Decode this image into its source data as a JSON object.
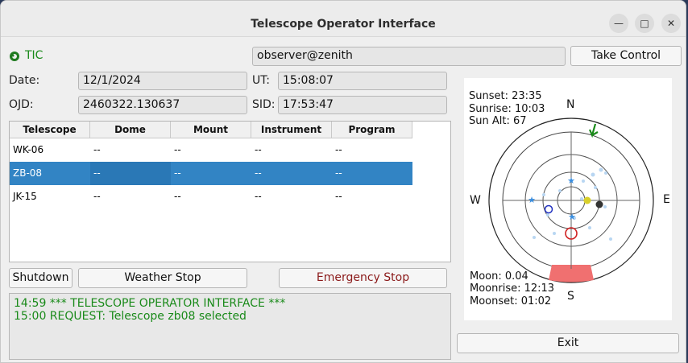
{
  "window": {
    "title": "Telescope Operator Interface"
  },
  "app_label": "TIC",
  "user_field": "observer@zenith",
  "take_control": "Take Control",
  "date": {
    "label": "Date:",
    "value": "12/1/2024"
  },
  "ut": {
    "label": "UT:",
    "value": "15:08:07"
  },
  "ojd": {
    "label": "OJD:",
    "value": "2460322.130637"
  },
  "sid": {
    "label": "SID:",
    "value": "17:53:47"
  },
  "table": {
    "headers": [
      "Telescope",
      "Dome",
      "Mount",
      "Instrument",
      "Program"
    ],
    "rows": [
      [
        "WK-06",
        "--",
        "--",
        "--",
        "--"
      ],
      [
        "ZB-08",
        "--",
        "--",
        "--",
        "--"
      ],
      [
        "JK-15",
        "--",
        "--",
        "--",
        "--"
      ]
    ],
    "selected_index": 1
  },
  "buttons": {
    "shutdown": "Shutdown",
    "weather_stop": "Weather Stop",
    "emergency_stop": "Emergency Stop",
    "exit": "Exit"
  },
  "log": [
    "14:59 *** TELESCOPE OPERATOR INTERFACE ***",
    "15:00 REQUEST: Telescope zb08 selected"
  ],
  "sky": {
    "sunset": "Sunset: 23:35",
    "sunrise": "Sunrise: 10:03",
    "sun_alt": "Sun Alt: 67",
    "moon": "Moon: 0.04",
    "moonrise": "Moonrise: 12:13",
    "moonset": "Moonset: 01:02",
    "n": "N",
    "s": "S",
    "e": "E",
    "w": "W"
  },
  "colors": {
    "selection": "#3284c4",
    "log_text": "#1a8a1a",
    "emergency_text": "#8b1a1a",
    "limit_zone": "#f07070"
  }
}
